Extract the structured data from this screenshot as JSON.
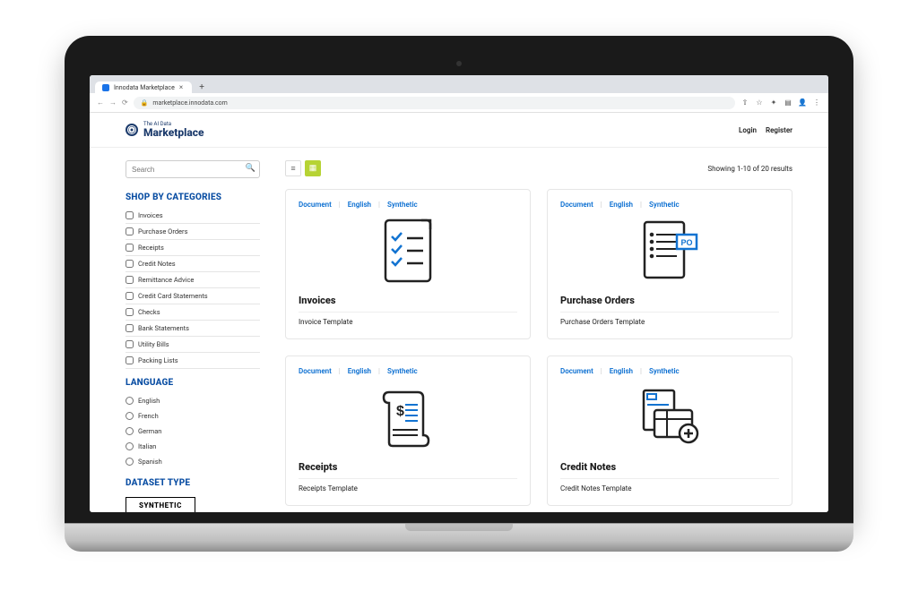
{
  "browser": {
    "tab_title": "Innodata Marketplace",
    "url_display": "marketplace.innodata.com"
  },
  "header": {
    "brand_sup": "The AI Data",
    "brand_main": "Marketplace",
    "login": "Login",
    "register": "Register"
  },
  "search": {
    "placeholder": "Search"
  },
  "filters": {
    "categories_title": "SHOP BY CATEGORIES",
    "categories": [
      "Invoices",
      "Purchase Orders",
      "Receipts",
      "Credit Notes",
      "Remittance Advice",
      "Credit Card Statements",
      "Checks",
      "Bank Statements",
      "Utility Bills",
      "Packing Lists"
    ],
    "language_title": "LANGUAGE",
    "languages": [
      "English",
      "French",
      "German",
      "Italian",
      "Spanish"
    ],
    "dataset_title": "DATASET TYPE",
    "dataset_chip": "SYNTHETIC"
  },
  "main": {
    "results_text": "Showing 1-10 of 20 results",
    "tags": {
      "t1": "Document",
      "t2": "English",
      "t3": "Synthetic"
    },
    "cards": [
      {
        "title": "Invoices",
        "sub": "Invoice Template"
      },
      {
        "title": "Purchase Orders",
        "sub": "Purchase Orders Template"
      },
      {
        "title": "Receipts",
        "sub": "Receipts Template"
      },
      {
        "title": "Credit Notes",
        "sub": "Credit Notes Template"
      }
    ]
  }
}
